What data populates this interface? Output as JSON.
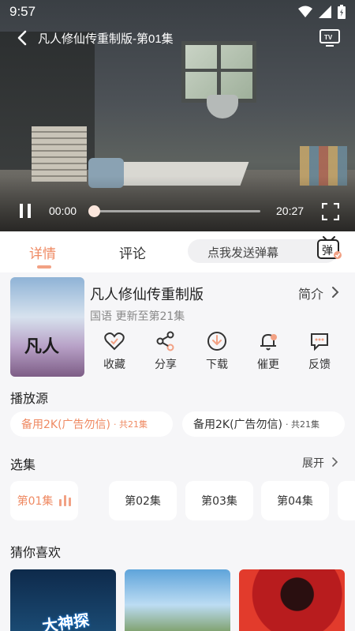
{
  "status_bar": {
    "time": "9:57"
  },
  "player": {
    "title": "凡人修仙传重制版-第01集",
    "current_time": "00:00",
    "duration": "20:27",
    "progress": 0.0
  },
  "tabs": [
    {
      "label": "详情",
      "active": true
    },
    {
      "label": "评论",
      "active": false
    }
  ],
  "danmu": {
    "placeholder": "点我发送弹幕",
    "icon_label": "弹"
  },
  "show": {
    "title": "凡人修仙传重制版",
    "subtitle": "国语 更新至第21集",
    "intro_label": "简介",
    "poster_title": "凡人"
  },
  "actions": [
    {
      "label": "收藏",
      "icon": "heart-icon"
    },
    {
      "label": "分享",
      "icon": "share-icon"
    },
    {
      "label": "下载",
      "icon": "download-icon"
    },
    {
      "label": "催更",
      "icon": "bell-icon"
    },
    {
      "label": "反馈",
      "icon": "feedback-icon"
    }
  ],
  "sources": {
    "title": "播放源",
    "items": [
      {
        "label": "备用2K(广告勿信)",
        "count": "· 共21集",
        "active": true
      },
      {
        "label": "备用2K(广告勿信)",
        "count": "· 共21集",
        "active": false
      }
    ]
  },
  "episodes": {
    "title": "选集",
    "expand_label": "展开",
    "items": [
      {
        "label": "第01集",
        "active": true
      },
      {
        "label": "第02集",
        "active": false
      },
      {
        "label": "第03集",
        "active": false
      },
      {
        "label": "第04集",
        "active": false
      }
    ]
  },
  "recommend": {
    "title": "猜你喜欢",
    "items": [
      {
        "overlay": "大神探"
      },
      {
        "overlay": ""
      },
      {
        "overlay": ""
      }
    ]
  },
  "colors": {
    "accent": "#ef8a63",
    "accent_light": "#f2a184",
    "background": "#f6f6f8"
  }
}
